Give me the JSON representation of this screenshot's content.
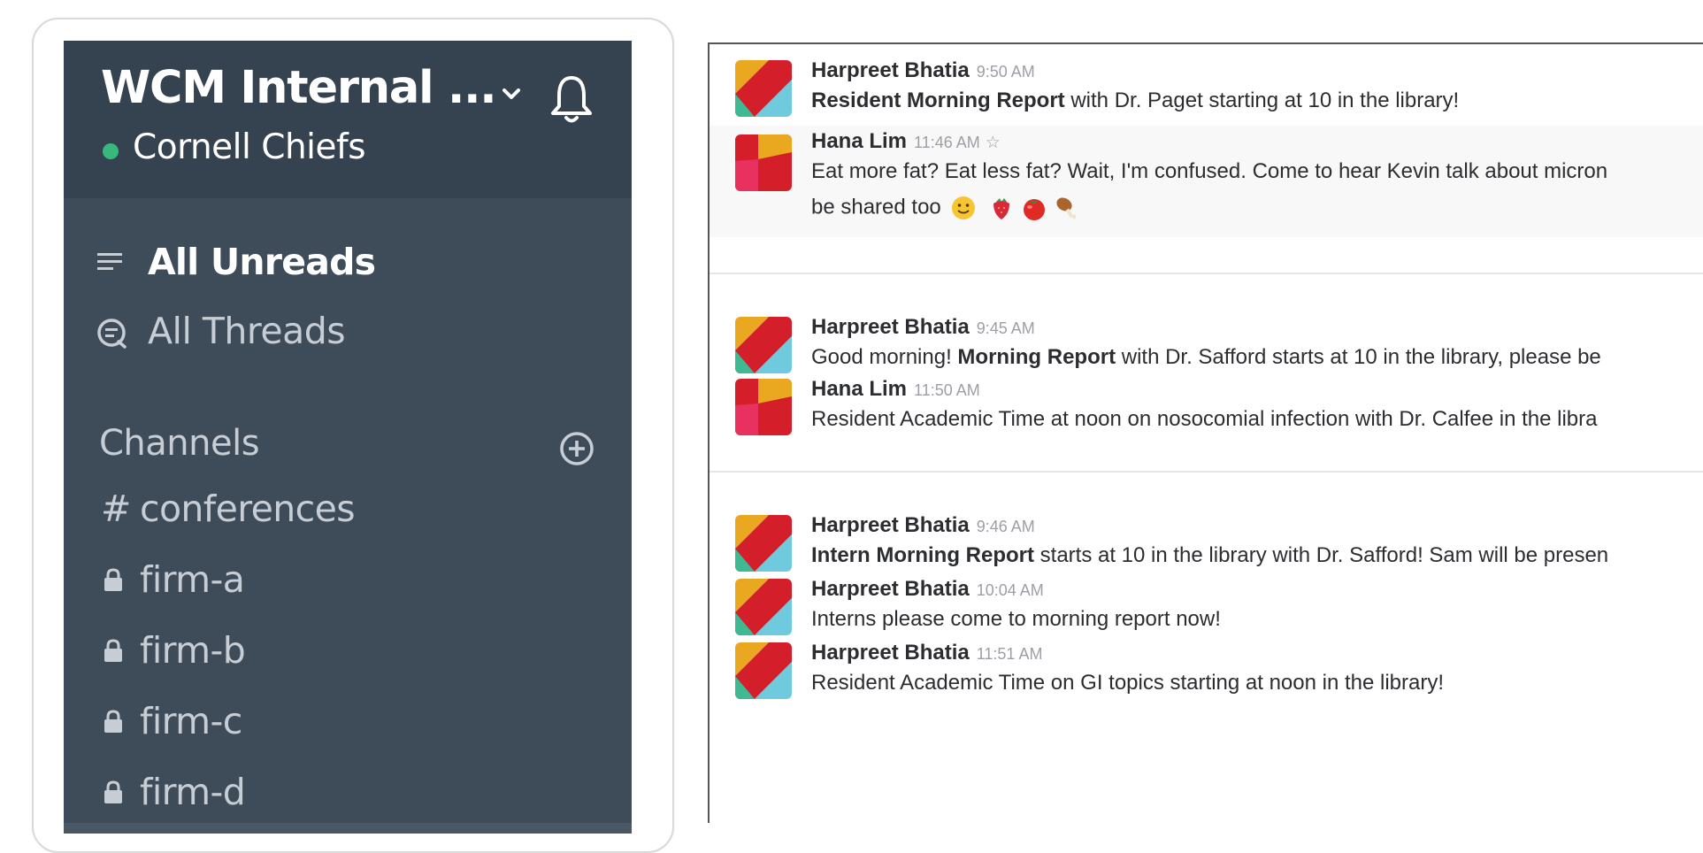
{
  "sidebar": {
    "team_name": "WCM Internal ...",
    "user_name": "Cornell Chiefs",
    "status_color": "#38b87c",
    "background": "#3e4c59",
    "nav": {
      "all_unreads": "All Unreads",
      "all_threads": "All Threads"
    },
    "channels_header": "Channels",
    "channels": [
      {
        "prefix": "#",
        "name": "conferences",
        "private": false
      },
      {
        "prefix": "lock-icon",
        "name": "firm-a",
        "private": true
      },
      {
        "prefix": "lock-icon",
        "name": "firm-b",
        "private": true
      },
      {
        "prefix": "lock-icon",
        "name": "firm-c",
        "private": true
      },
      {
        "prefix": "lock-icon",
        "name": "firm-d",
        "private": true
      }
    ]
  },
  "messages": [
    {
      "author": "Harpreet Bhatia",
      "time": "9:50 AM",
      "bold": "Resident Morning Report",
      "text": " with Dr. Paget starting at 10 in the library!"
    },
    {
      "author": "Hana Lim",
      "time": "11:46 AM",
      "starred": true,
      "line1": "Eat more fat? Eat less fat? Wait, I'm confused. Come to hear Kevin talk about micron",
      "line2": "be shared too",
      "emojis": [
        "slightly-smiling-face",
        "strawberry",
        "tomato",
        "poultry-leg"
      ]
    },
    {
      "author": "Harpreet Bhatia",
      "time": "9:45 AM",
      "pre": "Good morning! ",
      "bold": "Morning Report",
      "text": " with Dr. Safford starts at 10 in the library, please be"
    },
    {
      "author": "Hana Lim",
      "time": "11:50 AM",
      "text": "Resident Academic Time at noon on nosocomial infection with Dr. Calfee in the libra"
    },
    {
      "author": "Harpreet Bhatia",
      "time": "9:46 AM",
      "bold": "Intern Morning Report",
      "text": " starts at 10 in the library with Dr. Safford! Sam will be presen"
    },
    {
      "author": "Harpreet Bhatia",
      "time": "10:04 AM",
      "text": "Interns please come to morning report now!"
    },
    {
      "author": "Harpreet Bhatia",
      "time": "11:51 AM",
      "text": "Resident Academic Time on GI topics starting at noon in the library!"
    }
  ]
}
